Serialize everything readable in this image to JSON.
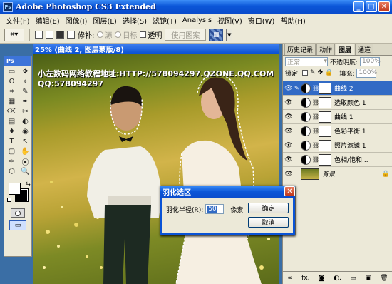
{
  "window": {
    "title": "Adobe Photoshop CS3 Extended",
    "app_badge": "Ps",
    "minimize": "_",
    "maximize": "□",
    "close": "✕"
  },
  "menu": [
    "文件(F)",
    "编辑(E)",
    "图像(I)",
    "图层(L)",
    "选择(S)",
    "滤镜(T)",
    "Analysis",
    "视图(V)",
    "窗口(W)",
    "帮助(H)"
  ],
  "options": {
    "feather_label": "修补:",
    "source_label": "源",
    "target_label": "目标",
    "transparent_label": "透明",
    "use_pattern_label": "使用图案"
  },
  "toolbox": {
    "header": "Ps",
    "tools": [
      "▭",
      "✥",
      "ʘ",
      "⌖",
      "⌗",
      "✎",
      "▦",
      "✒",
      "⌫",
      "✂",
      "▤",
      "◐",
      "♦",
      "◉",
      "T",
      "↖",
      "▢",
      "✋",
      "✑",
      "⦿",
      "⬡",
      "🔍"
    ]
  },
  "document": {
    "title": "25% (曲线 2, 图层蒙版/8)",
    "watermark_line1": "小左数码网络教程地址:HTTP://578094297.QZONE.QQ.COM",
    "watermark_line2": "QQ:578094297"
  },
  "panel": {
    "tabs": [
      "历史记录",
      "动作",
      "图层",
      "通道"
    ],
    "active_tab": "图层",
    "blend_mode": "正常",
    "opacity_label": "不透明度:",
    "opacity_value": "100%",
    "lock_label": "锁定:",
    "fill_label": "填充:",
    "fill_value": "100%",
    "layers": [
      {
        "name": "曲线 2",
        "selected": true
      },
      {
        "name": "选取颜色 1",
        "selected": false
      },
      {
        "name": "曲线 1",
        "selected": false
      },
      {
        "name": "色彩平衡 1",
        "selected": false
      },
      {
        "name": "照片滤镜 1",
        "selected": false
      },
      {
        "name": "色相/饱和...",
        "selected": false
      },
      {
        "name": "背景",
        "selected": false
      }
    ],
    "footer_icons": [
      "∞",
      "fx.",
      "◙",
      "◐.",
      "▭",
      "▣",
      "🗑"
    ]
  },
  "dialog": {
    "title": "羽化选区",
    "radius_label": "羽化半径(R):",
    "radius_value": "50",
    "unit": "像素",
    "ok_label": "确定",
    "cancel_label": "取消"
  }
}
